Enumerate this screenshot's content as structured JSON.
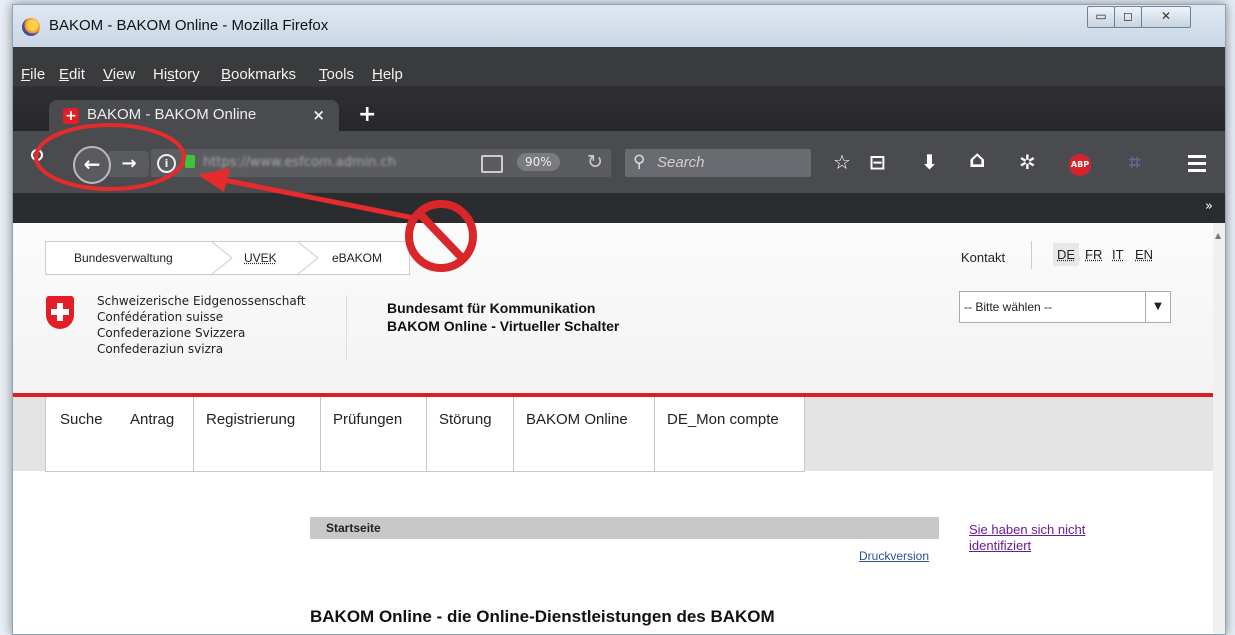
{
  "window": {
    "title": "BAKOM - BAKOM Online - Mozilla Firefox",
    "controls": {
      "min": "▭",
      "max": "◻",
      "close": "✕"
    }
  },
  "menu": [
    {
      "pre": "",
      "u": "F",
      "post": "ile"
    },
    {
      "pre": "",
      "u": "E",
      "post": "dit"
    },
    {
      "pre": "",
      "u": "V",
      "post": "iew"
    },
    {
      "pre": "Hi",
      "u": "s",
      "post": "tory"
    },
    {
      "pre": "",
      "u": "B",
      "post": "ookmarks"
    },
    {
      "pre": "",
      "u": "T",
      "post": "ools"
    },
    {
      "pre": "",
      "u": "H",
      "post": "elp"
    }
  ],
  "tab": {
    "label": "BAKOM - BAKOM Online",
    "close": "×",
    "new_tab": "+",
    "favicon": "+"
  },
  "nav": {
    "back": "←",
    "forward": "→",
    "info": "i",
    "url": "https://www.esfcom.admin.ch",
    "zoom": "90%",
    "reload": "↻",
    "search_placeholder": "Search",
    "search_icon": "⚲",
    "toolbar_icons": {
      "bookmark": "☆",
      "reading_list": "⊟",
      "download": "⬇",
      "home": "⌂",
      "settings": "✲",
      "abp": "ABP",
      "crop": "⌗"
    },
    "overflow": "»"
  },
  "breadcrumbs": [
    "Bundesverwaltung",
    "UVEK",
    "eBAKOM"
  ],
  "header": {
    "kontakt": "Kontakt",
    "languages": [
      "DE",
      "FR",
      "IT",
      "EN"
    ],
    "active_language": "DE",
    "confederation": [
      "Schweizerische Eidgenossenschaft",
      "Confédération suisse",
      "Confederazione Svizzera",
      "Confederaziun svizra"
    ],
    "office": "Bundesamt für Kommunikation",
    "subtitle": "BAKOM Online - Virtueller Schalter",
    "select_value": "-- Bitte wählen --",
    "select_arrow": "▼"
  },
  "main_nav": [
    "Suche",
    "Antrag",
    "Registrierung",
    "Prüfungen",
    "Störung",
    "BAKOM Online",
    "DE_Mon compte"
  ],
  "content": {
    "startseite": "Startseite",
    "druckversion": "Druckversion",
    "not_identified": "Sie haben sich nicht identifiziert",
    "heading": "BAKOM Online - die Online-Dienstleistungen des BAKOM"
  },
  "colors": {
    "accent_red": "#dd1c24",
    "annotation_red": "#e52b2b",
    "link": "#2b4f9c",
    "visited_link": "#6a1b9a"
  }
}
